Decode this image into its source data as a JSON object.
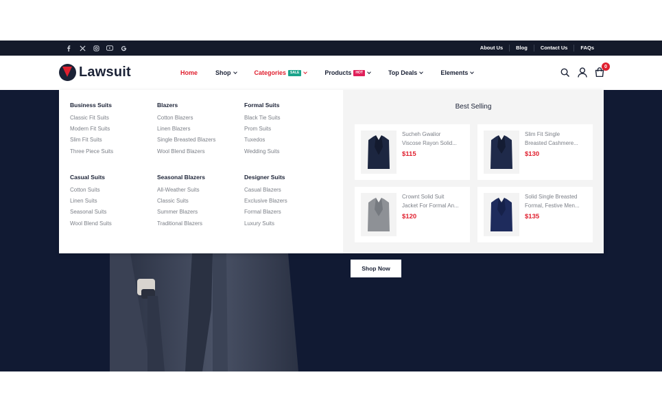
{
  "topbar": {
    "social_icons": [
      "facebook-icon",
      "x-icon",
      "instagram-icon",
      "youtube-icon",
      "google-icon"
    ],
    "links": [
      "About Us",
      "Blog",
      "Contact Us",
      "FAQs"
    ]
  },
  "header": {
    "brand": "Lawsuit",
    "nav": [
      {
        "label": "Home",
        "active": true
      },
      {
        "label": "Shop",
        "dropdown": true
      },
      {
        "label": "Categories",
        "badge": "SALE",
        "dropdown": true
      },
      {
        "label": "Products",
        "badge": "HOT",
        "dropdown": true
      },
      {
        "label": "Top Deals",
        "dropdown": true
      },
      {
        "label": "Elements",
        "dropdown": true
      }
    ],
    "cart_count": "0",
    "icons": [
      "search-icon",
      "user-icon",
      "cart-icon"
    ]
  },
  "mega_menu": {
    "columns": [
      {
        "heading": "Business Suits",
        "items": [
          "Classic Fit Suits",
          "Modern Fit Suits",
          "Slim Fit Suits",
          "Three Piece Suits"
        ]
      },
      {
        "heading": "Blazers",
        "items": [
          "Cotton Blazers",
          "Linen Blazers",
          "Single Breasted Blazers",
          "Wool Blend Blazers"
        ]
      },
      {
        "heading": "Formal Suits",
        "items": [
          "Black Tie Suits",
          "Prom Suits",
          "Tuxedos",
          "Wedding Suits"
        ]
      },
      {
        "heading": "Casual Suits",
        "items": [
          "Cotton Suits",
          "Linen Suits",
          "Seasonal Suits",
          "Wool Blend Suits"
        ]
      },
      {
        "heading": "Seasonal Blazers",
        "items": [
          "All-Weather Suits",
          "Classic Suits",
          "Summer Blazers",
          "Traditional Blazers"
        ]
      },
      {
        "heading": "Designer Suits",
        "items": [
          "Casual Blazers",
          "Exclusive Blazers",
          "Formal Blazers",
          "Luxury Suits"
        ]
      }
    ],
    "best_selling": {
      "title": "Best Selling",
      "products": [
        {
          "line1": "Sucheh Gwalior",
          "line2": "Viscose Rayon Solid...",
          "price": "$115",
          "color": "#1c2640"
        },
        {
          "line1": "Slim Fit Single",
          "line2": "Breasted Cashmere...",
          "price": "$130",
          "color": "#1f2a4a"
        },
        {
          "line1": "Crownt Solid Suit",
          "line2": "Jacket For Formal An...",
          "price": "$120",
          "color": "#8e9196"
        },
        {
          "line1": "Solid Single Breasted",
          "line2": "Formal, Festive Men...",
          "price": "$135",
          "color": "#1e2b5c"
        }
      ]
    }
  },
  "hero": {
    "cta": "Shop Now"
  },
  "colors": {
    "accent": "#e0202f",
    "dark": "#141a2a",
    "hero_bg": "#111a33"
  }
}
